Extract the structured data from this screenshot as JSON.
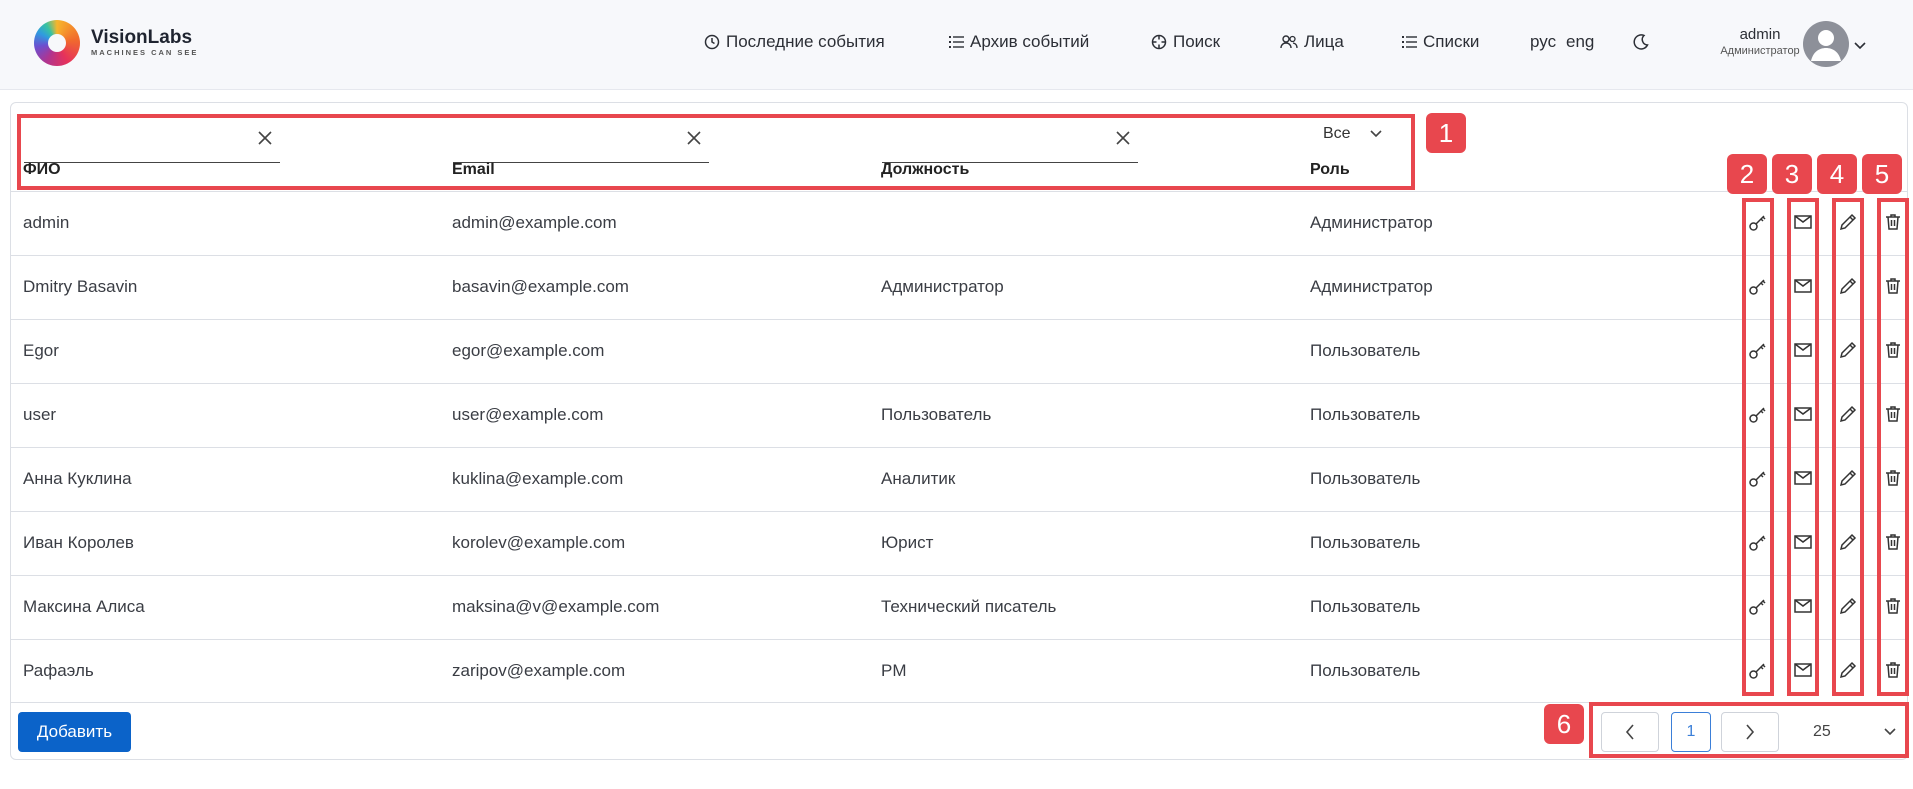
{
  "header": {
    "logo_title": "VisionLabs",
    "logo_subtitle": "MACHINES CAN SEE",
    "nav": [
      {
        "label": "Последние события",
        "icon": "clock-icon"
      },
      {
        "label": "Архив событий",
        "icon": "list-icon"
      },
      {
        "label": "Поиск",
        "icon": "crosshair-icon"
      },
      {
        "label": "Лица",
        "icon": "people-icon"
      },
      {
        "label": "Списки",
        "icon": "list-icon"
      }
    ],
    "lang_ru": "рус",
    "lang_en": "eng",
    "user_name": "admin",
    "user_role": "Администратор"
  },
  "filters": {
    "name_value": "",
    "email_value": "",
    "position_value": "",
    "role_value": "Все"
  },
  "columns": {
    "name": "ФИО",
    "email": "Email",
    "position": "Должность",
    "role": "Роль"
  },
  "rows": [
    {
      "name": "admin",
      "email": "admin@example.com",
      "position": "",
      "role": "Администратор"
    },
    {
      "name": "Dmitry Basavin",
      "email": "basavin@example.com",
      "position": "Администратор",
      "role": "Администратор"
    },
    {
      "name": "Egor",
      "email": "egor@example.com",
      "position": "",
      "role": "Пользователь"
    },
    {
      "name": "user",
      "email": "user@example.com",
      "position": "Пользователь",
      "role": "Пользователь"
    },
    {
      "name": "Анна Куклина",
      "email": "kuklina@example.com",
      "position": "Аналитик",
      "role": "Пользователь"
    },
    {
      "name": "Иван Королев",
      "email": "korolev@example.com",
      "position": "Юрист",
      "role": "Пользователь"
    },
    {
      "name": "Максина Алиса",
      "email": "maksina@v@example.com",
      "position": "Технический писатель",
      "role": "Пользователь"
    },
    {
      "name": "Рафаэль",
      "email": "zaripov@example.com",
      "position": "PM",
      "role": "Пользователь"
    }
  ],
  "footer": {
    "add_label": "Добавить",
    "page": "1",
    "page_size": "25"
  },
  "annotations": [
    "1",
    "2",
    "3",
    "4",
    "5",
    "6"
  ],
  "colors": {
    "accent": "#0b63c9",
    "annotation_red": "#e8474e"
  }
}
